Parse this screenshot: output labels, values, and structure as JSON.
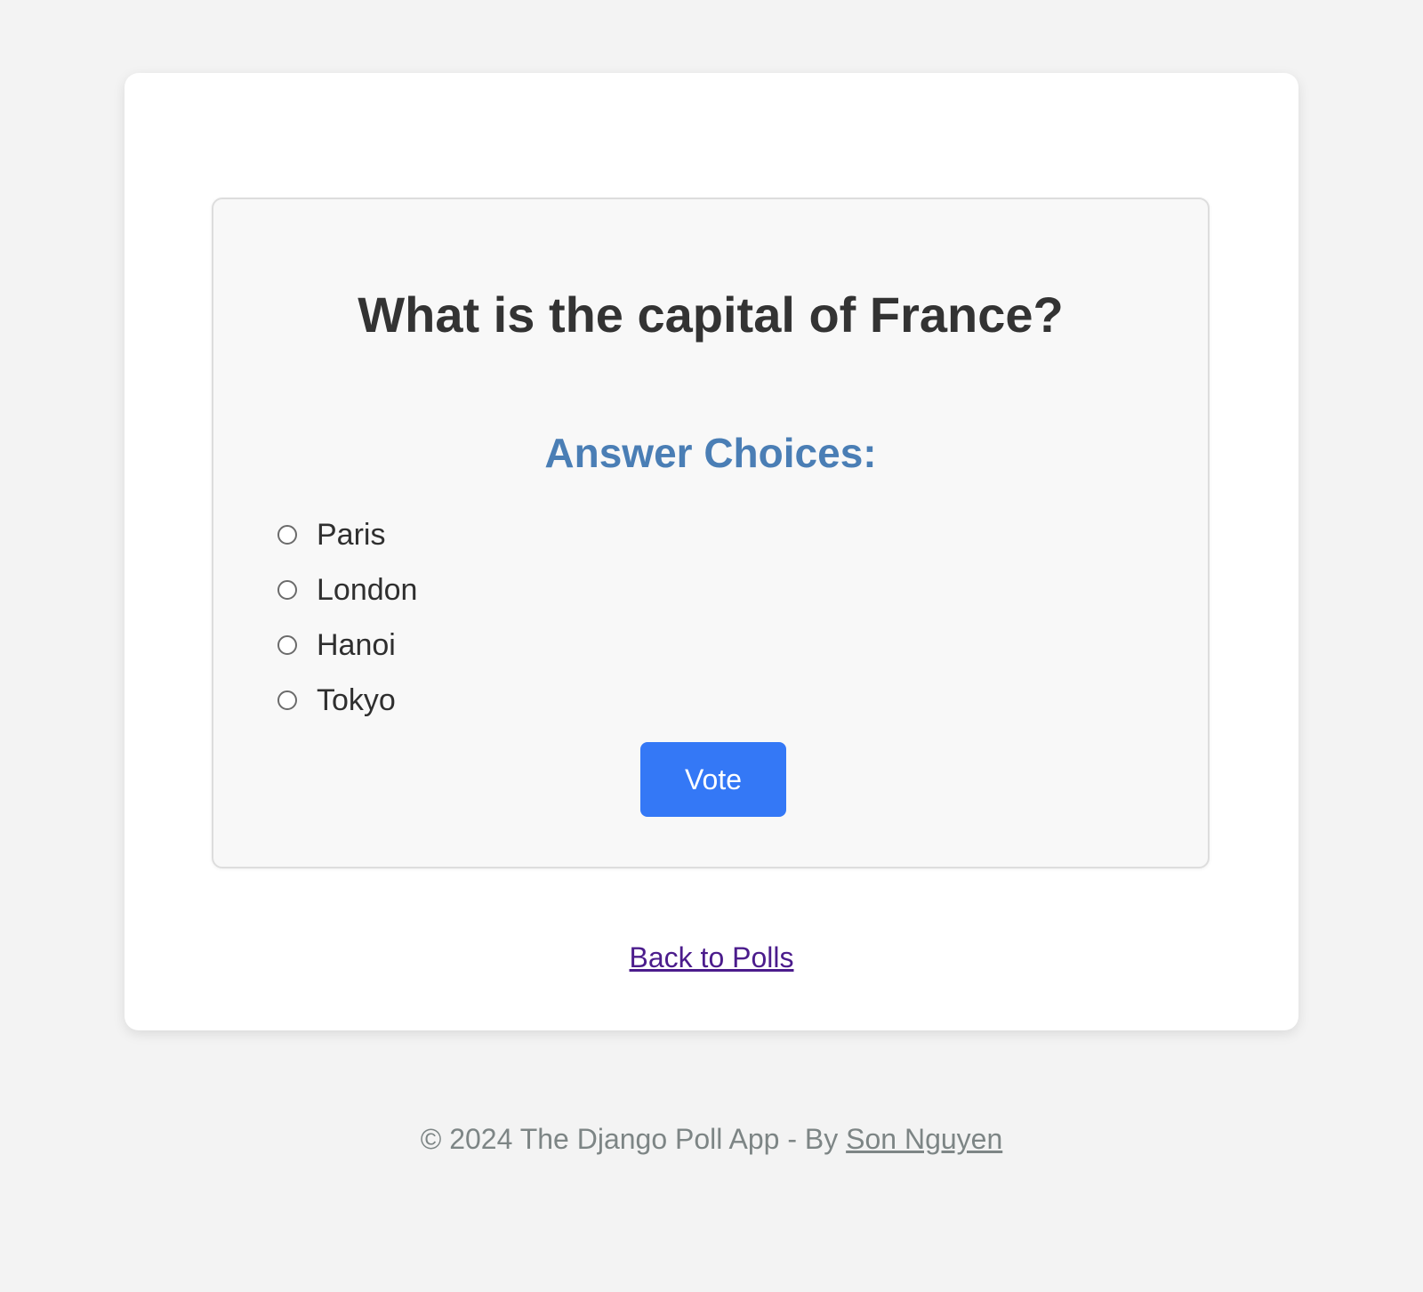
{
  "poll": {
    "question": "What is the capital of France?",
    "choices_heading": "Answer Choices:",
    "choices": [
      {
        "label": "Paris",
        "selected": false
      },
      {
        "label": "London",
        "selected": false
      },
      {
        "label": "Hanoi",
        "selected": false
      },
      {
        "label": "Tokyo",
        "selected": false
      }
    ],
    "vote_label": "Vote"
  },
  "nav": {
    "back_label": "Back to Polls"
  },
  "footer": {
    "text": "© 2024 The Django Poll App - By ",
    "author": "Son Nguyen"
  },
  "colors": {
    "page_background": "#f3f3f3",
    "card_background": "#ffffff",
    "poll_card_background": "#f8f8f8",
    "heading_accent": "#4a7eb5",
    "vote_button": "#3478f6",
    "link_visited": "#4b1c8c",
    "footer_text": "#7d8585"
  }
}
